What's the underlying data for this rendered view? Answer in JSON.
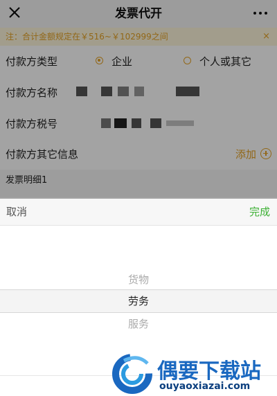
{
  "nav": {
    "title": "发票代开",
    "close_icon": "close-icon",
    "more_icon": "more-dots-icon"
  },
  "notice": {
    "text": "注：合计金额规定在￥516~￥102999之间",
    "close": "×"
  },
  "form": {
    "payer_type": {
      "label": "付款方类型",
      "options": [
        "企业",
        "个人或其它"
      ],
      "selected": "企业"
    },
    "payer_name": {
      "label": "付款方名称"
    },
    "payer_tax_id": {
      "label": "付款方税号"
    },
    "payer_other": {
      "label": "付款方其它信息",
      "action": "添加"
    },
    "section": {
      "label": "发票明细1"
    }
  },
  "picker": {
    "cancel": "取消",
    "done": "完成",
    "options": [
      "货物",
      "劳务",
      "服务"
    ],
    "selected": "劳务"
  },
  "watermark": {
    "title": "偶要下载站",
    "url": "ouyaoxiazai.com"
  },
  "colors": {
    "accent": "#e5a224",
    "done": "#3cb034",
    "watermark": "#1a68c0"
  }
}
